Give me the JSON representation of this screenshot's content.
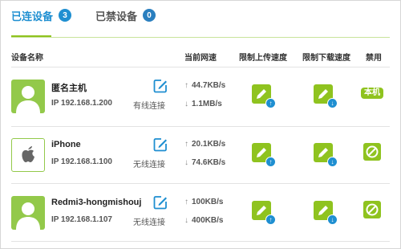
{
  "tabs": [
    {
      "label": "已连设备",
      "count": "3"
    },
    {
      "label": "已禁设备",
      "count": "0"
    }
  ],
  "columns": {
    "name": "设备名称",
    "speed": "当前网速",
    "upload_limit": "限制上传速度",
    "download_limit": "限制下载速度",
    "ban": "禁用"
  },
  "devices": [
    {
      "name": "匿名主机",
      "ip": "IP 192.168.1.200",
      "connection": "有线连接",
      "up_speed": "44.7KB/s",
      "down_speed": "1.1MB/s",
      "icon": "user-icon",
      "ban_label": "本机"
    },
    {
      "name": "iPhone",
      "ip": "IP 192.168.1.100",
      "connection": "无线连接",
      "up_speed": "20.1KB/s",
      "down_speed": "74.6KB/s",
      "icon": "apple-icon",
      "ban_label": ""
    },
    {
      "name": "Redmi3-hongmishouj",
      "ip": "IP 192.168.1.107",
      "connection": "无线连接",
      "up_speed": "100KB/s",
      "down_speed": "400KB/s",
      "icon": "user-icon",
      "ban_label": ""
    }
  ],
  "arrows": {
    "up": "↑",
    "down": "↓"
  },
  "colors": {
    "accent_blue": "#1f8fd1",
    "accent_green": "#8fc31f"
  }
}
